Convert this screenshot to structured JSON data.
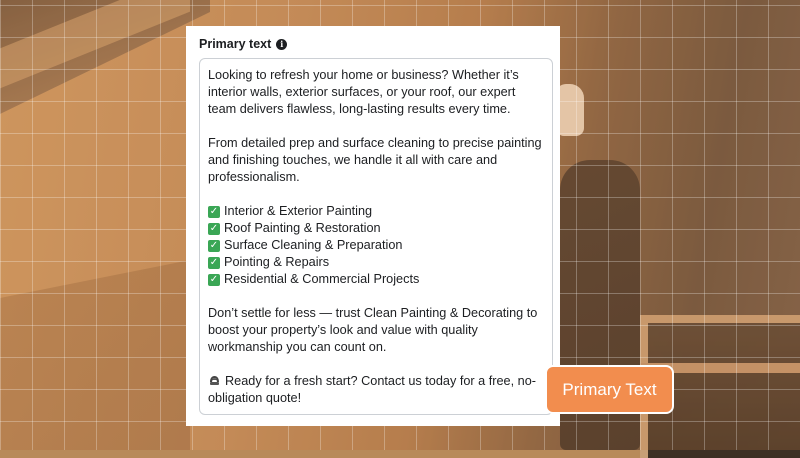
{
  "card": {
    "title": "Primary text",
    "info_icon": "info-icon",
    "paragraph_1": "Looking to refresh your home or business? Whether it’s interior walls, exterior surfaces, or your roof, our expert team delivers flawless, long-lasting results every time.",
    "paragraph_2": "From detailed prep and surface cleaning to precise painting and finishing touches, we handle it all with care and professionalism.",
    "services": [
      {
        "icon": "check-mark-icon",
        "label": "Interior & Exterior Painting"
      },
      {
        "icon": "check-mark-icon",
        "label": "Roof Painting & Restoration"
      },
      {
        "icon": "check-mark-icon",
        "label": "Surface Cleaning & Preparation"
      },
      {
        "icon": "check-mark-icon",
        "label": "Pointing & Repairs"
      },
      {
        "icon": "check-mark-icon",
        "label": "Residential & Commercial Projects"
      }
    ],
    "paragraph_3": "Don’t settle for less — trust Clean Painting & Decorating to boost your property’s look and value with quality workmanship you can count on.",
    "cta_icon": "telephone-icon",
    "cta": "Ready for a fresh start? Contact us today for a free, no-obligation quote!"
  },
  "badge": {
    "label": "Primary Text",
    "color": "#f28d4e"
  },
  "colors": {
    "check_green": "#3aa655",
    "text": "#1c1e21",
    "border": "#ccd0d5"
  }
}
